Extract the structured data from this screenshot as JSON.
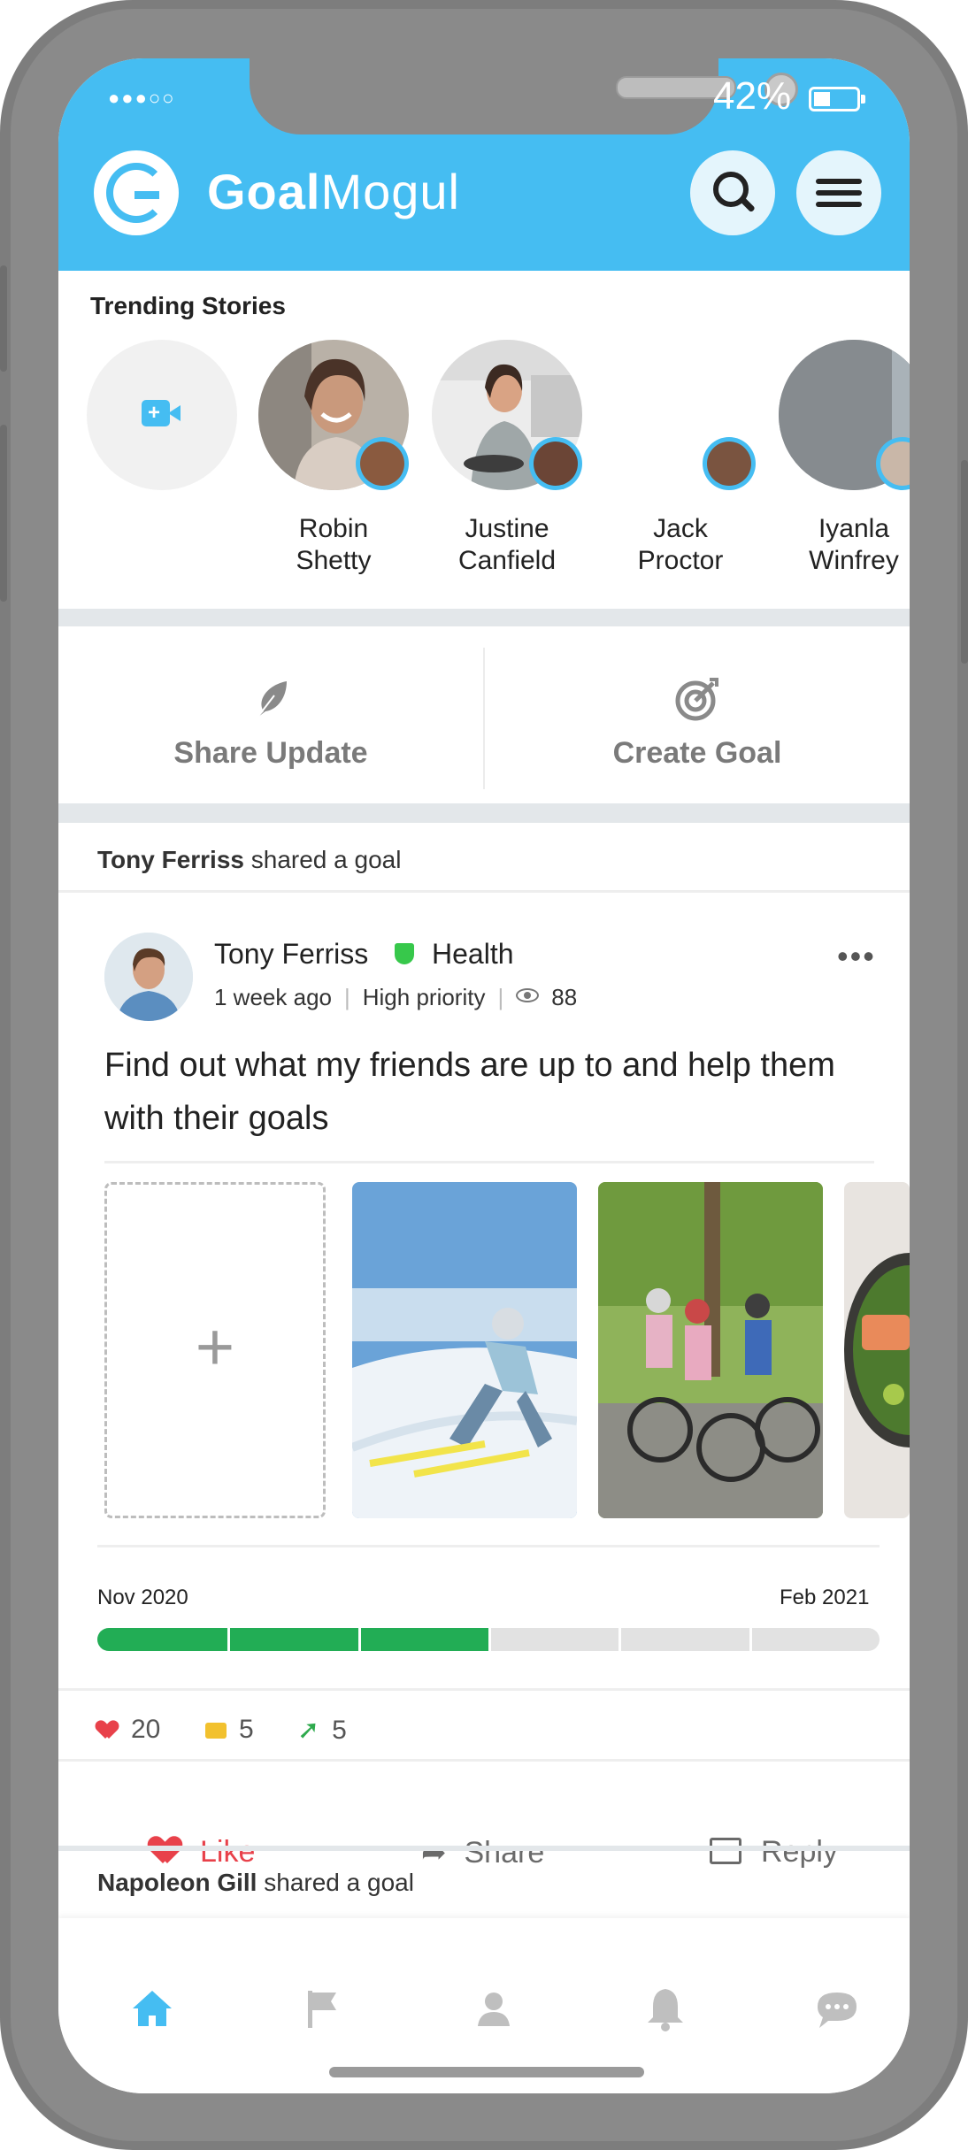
{
  "status_bar": {
    "signal": "●●●○○",
    "battery": "42%"
  },
  "header": {
    "brand_bold": "Goal",
    "brand_light": "Mogul"
  },
  "trending": {
    "title": "Trending Stories",
    "stories": [
      {
        "first": "Robin",
        "last": "Shetty"
      },
      {
        "first": "Justine",
        "last": "Canfield"
      },
      {
        "first": "Jack",
        "last": "Proctor"
      },
      {
        "first": "Iyanla",
        "last": "Winfrey"
      }
    ]
  },
  "composer": {
    "share_update": "Share Update",
    "create_goal": "Create Goal"
  },
  "feed": {
    "post1_header": {
      "name": "Tony Ferriss",
      "action": "shared a goal"
    },
    "post": {
      "author": "Tony Ferriss",
      "category": "Health",
      "time": "1 week ago",
      "priority": "High priority",
      "views": "88",
      "text": "Find out what my friends are up to and help them with their goals",
      "start_date": "Nov 2020",
      "end_date": "Feb 2021",
      "progress": 0.5,
      "progress_segments": 6,
      "likes": "20",
      "comments": "5",
      "shares": "5",
      "like_label": "Like",
      "share_label": "Share",
      "reply_label": "Reply"
    },
    "post2_header": {
      "name": "Napoleon Gill",
      "action": "shared a goal"
    }
  },
  "tabs": [
    "home-icon",
    "flag-icon",
    "profile-icon",
    "bell-icon",
    "chat-icon"
  ],
  "colors": {
    "brand_blue": "#45bdf2",
    "progress_green": "#22ad55",
    "like_red": "#e8414a",
    "comment_yellow": "#f2c12e"
  }
}
